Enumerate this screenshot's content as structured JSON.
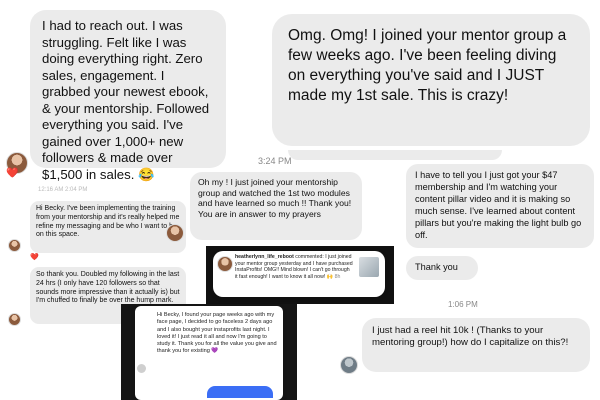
{
  "screenshot1": {
    "message": "I had to reach out. I was struggling. Felt like I was doing everything right. Zero sales, engagement. I grabbed your newest ebook, & your mentorship. Followed everything you said. I've gained over 1,000+ new followers & made over $1,500 in sales. 😂",
    "heart": "❤️"
  },
  "screenshot2": {
    "message": "Omg. Omg! I joined your mentor group a few weeks ago. I've been feeling diving on everything you've said and I JUST made my 1st sale. This is crazy!",
    "timestamp": "3:24 PM"
  },
  "screenshot3": {
    "faint_timestamp": "12:16 AM  2:04 PM",
    "message1": "Hi Becky. I've been implementing the training from your mentorship and it's really helped me refine my messaging and be who I want to be on this space.",
    "heart": "❤️",
    "message2": "So thank you. Doubled my following in the last 24 hrs (I only have 120 followers so that sounds more impressive than it actually is) but I'm chuffed to finally be over the hump mark."
  },
  "screenshot4": {
    "message": "Oh my ! I just joined your mentorship group and watched the 1st two modules and have learned so much !! Thank you! You are in answer to my prayers"
  },
  "screenshot5": {
    "message1": "I have to tell you I just got your $47 membership and I'm watching your content pillar video and it is making so much sense. I've learned about content pillars but you're making the light bulb go off.",
    "message2": "Thank you",
    "timestamp": "1:06 PM",
    "message3": "I just had a reel hit 10k ! (Thanks to your mentoring group!) how do I capitalize on this?!"
  },
  "screenshot6": {
    "username": "heatherlynn_life_reboot",
    "action": "commented:",
    "comment": "I just joined your mentor group yesterday and I have purchased InstaProfits! OMG!! Mind blown! I can't go through it fast enough! I want to know it all now! 🙌",
    "meta": "8h"
  },
  "screenshot7": {
    "message": "Hi Becky, I found your page weeks ago with my face page, I decided to go faceless 2 days ago and I also bought your instaprofits last night. I loved it! I just read it all and now I'm going to study it. Thank you for all the value you give and thank you for existing 💜"
  }
}
